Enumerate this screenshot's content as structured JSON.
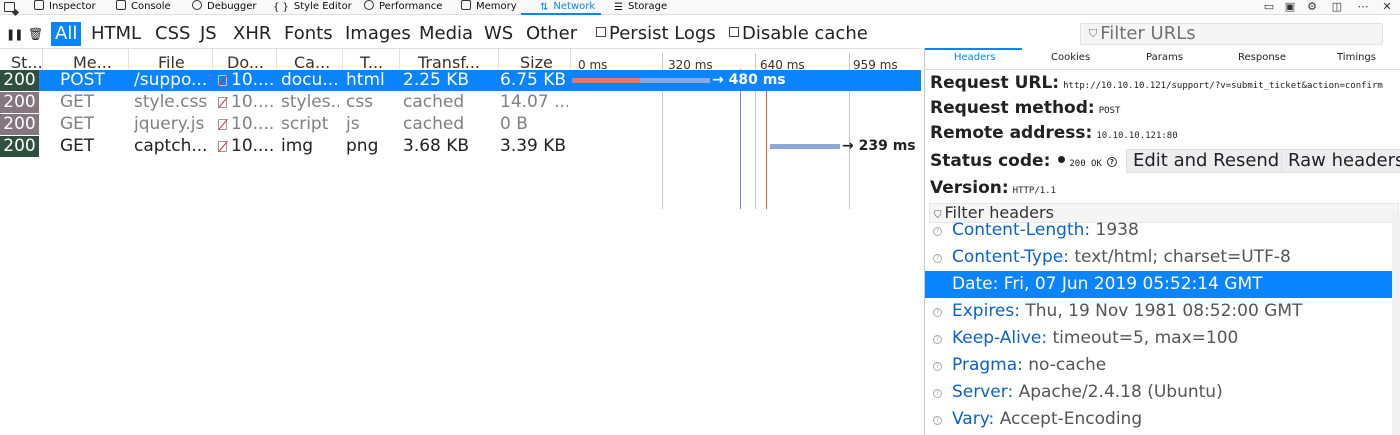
{
  "devtools_tabs": [
    {
      "label": "Inspector",
      "icon": "inspector-icon"
    },
    {
      "label": "Console",
      "icon": "console-icon"
    },
    {
      "label": "Debugger",
      "icon": "debugger-icon"
    },
    {
      "label": "Style Editor",
      "icon": "style-editor-icon"
    },
    {
      "label": "Performance",
      "icon": "performance-icon"
    },
    {
      "label": "Memory",
      "icon": "memory-icon"
    },
    {
      "label": "Network",
      "icon": "network-icon",
      "active": true
    },
    {
      "label": "Storage",
      "icon": "storage-icon"
    }
  ],
  "toolbar": {
    "filters": [
      "All",
      "HTML",
      "CSS",
      "JS",
      "XHR",
      "Fonts",
      "Images",
      "Media",
      "WS",
      "Other"
    ],
    "active_filter": "All",
    "persist_logs": "Persist Logs",
    "disable_cache": "Disable cache",
    "filter_urls_placeholder": "Filter URLs"
  },
  "table": {
    "columns": [
      "St...",
      "Me...",
      "File",
      "Do...",
      "Ca...",
      "T...",
      "Transf...",
      "Size"
    ],
    "waterfall_ticks": [
      "0 ms",
      "320 ms",
      "640 ms",
      "959 ms"
    ],
    "rows": [
      {
        "status": "200",
        "method": "POST",
        "file": "/suppo...",
        "domain": "10....",
        "cause": "docu...",
        "type": "html",
        "transferred": "2.25 KB",
        "size": "6.75 KB",
        "timing": "→ 480 ms",
        "selected": true,
        "cached": false
      },
      {
        "status": "200",
        "method": "GET",
        "file": "style.css",
        "domain": "10....",
        "cause": "styles...",
        "type": "css",
        "transferred": "cached",
        "size": "14.07 ...",
        "timing": "",
        "selected": false,
        "cached": true
      },
      {
        "status": "200",
        "method": "GET",
        "file": "jquery.js",
        "domain": "10....",
        "cause": "script",
        "type": "js",
        "transferred": "cached",
        "size": "0 B",
        "timing": "",
        "selected": false,
        "cached": true
      },
      {
        "status": "200",
        "method": "GET",
        "file": "captch...",
        "domain": "10....",
        "cause": "img",
        "type": "png",
        "transferred": "3.68 KB",
        "size": "3.39 KB",
        "timing": "→ 239 ms",
        "selected": false,
        "cached": false
      }
    ]
  },
  "side_panel": {
    "tabs": [
      "Headers",
      "Cookies",
      "Params",
      "Response",
      "Timings"
    ],
    "active_tab": "Headers",
    "request_url_label": "Request URL:",
    "request_url": "http://10.10.10.121/support/?v=submit_ticket&action=confirm",
    "request_method_label": "Request method:",
    "request_method": "POST",
    "remote_address_label": "Remote address:",
    "remote_address": "10.10.10.121:80",
    "status_code_label": "Status code:",
    "status_code": "200 OK",
    "edit_resend": "Edit and Resend",
    "raw_headers": "Raw headers",
    "version_label": "Version:",
    "version": "HTTP/1.1",
    "filter_headers_placeholder": "Filter headers",
    "headers": [
      {
        "key": "Content-Length:",
        "value": "1938"
      },
      {
        "key": "Content-Type:",
        "value": "text/html; charset=UTF-8"
      },
      {
        "key": "Date:",
        "value": "Fri, 07 Jun 2019 05:52:14 GMT",
        "selected": true
      },
      {
        "key": "Expires:",
        "value": "Thu, 19 Nov 1981 08:52:00 GMT"
      },
      {
        "key": "Keep-Alive:",
        "value": "timeout=5, max=100"
      },
      {
        "key": "Pragma:",
        "value": "no-cache"
      },
      {
        "key": "Server:",
        "value": "Apache/2.4.18 (Ubuntu)"
      },
      {
        "key": "Vary:",
        "value": "Accept-Encoding"
      }
    ]
  },
  "colors": {
    "accent": "#0a84ff",
    "status_ok": "#2f4f3f",
    "status_cached": "#86767f",
    "header_key": "#0a62c9"
  }
}
